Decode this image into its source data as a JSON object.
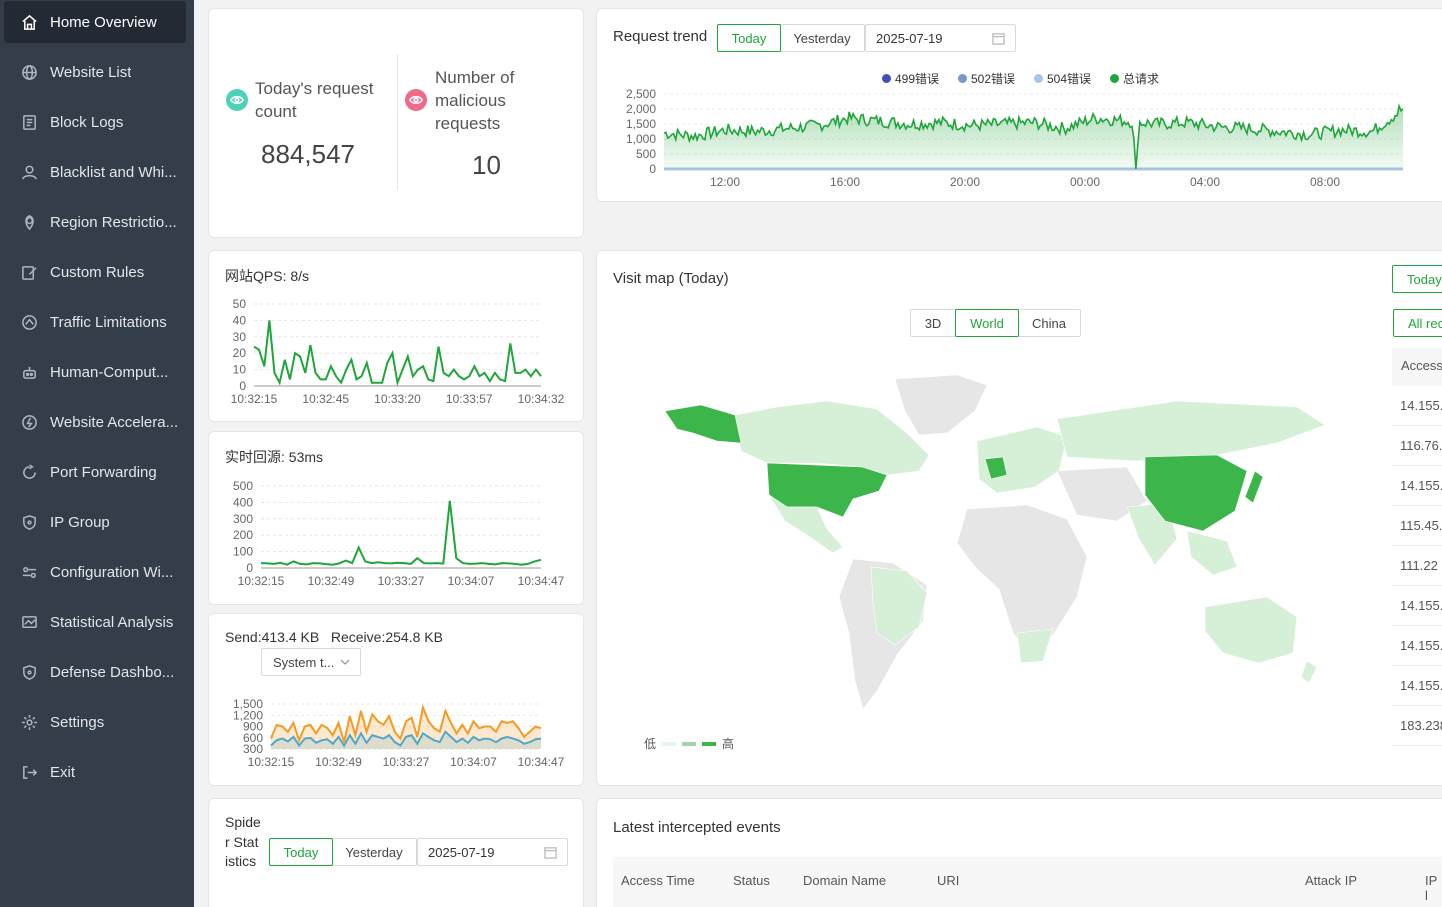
{
  "sidebar": {
    "items": [
      {
        "label": "Home Overview",
        "icon": "home-icon",
        "active": true
      },
      {
        "label": "Website List",
        "icon": "globe-icon"
      },
      {
        "label": "Block Logs",
        "icon": "log-icon"
      },
      {
        "label": "Blacklist and Whi...",
        "icon": "user-icon"
      },
      {
        "label": "Region Restrictio...",
        "icon": "location-icon"
      },
      {
        "label": "Custom Rules",
        "icon": "edit-icon"
      },
      {
        "label": "Traffic Limitations",
        "icon": "traffic-icon"
      },
      {
        "label": "Human-Comput...",
        "icon": "robot-icon"
      },
      {
        "label": "Website Accelera...",
        "icon": "lightning-icon"
      },
      {
        "label": "Port Forwarding",
        "icon": "forward-icon"
      },
      {
        "label": "IP Group",
        "icon": "shield-icon"
      },
      {
        "label": "Configuration Wi...",
        "icon": "config-icon"
      },
      {
        "label": "Statistical Analysis",
        "icon": "chart-icon"
      },
      {
        "label": "Defense Dashbo...",
        "icon": "shield-icon"
      },
      {
        "label": "Settings",
        "icon": "gear-icon"
      },
      {
        "label": "Exit",
        "icon": "exit-icon"
      }
    ]
  },
  "stats": {
    "requests_label": "Today's request count",
    "requests_value": "884,547",
    "malicious_label": "Number of malicious requests",
    "malicious_value": "10",
    "accent_green": "#20a53a",
    "accent_pink": "#f06b8a",
    "accent_teal": "#4fd1b5"
  },
  "trend": {
    "title": "Request trend",
    "tabs": [
      "Today",
      "Yesterday"
    ],
    "active_tab": "Today",
    "date": "2025-07-19"
  },
  "qps": {
    "title": "网站QPS: 8/s"
  },
  "origin": {
    "title": "实时回源: 53ms"
  },
  "traffic": {
    "send_label": "Send:",
    "send_value": "413.4 KB",
    "receive_label": "Receive:",
    "receive_value": "254.8 KB",
    "select_value": "System t..."
  },
  "spider": {
    "title": "Spider Statistics",
    "tabs": [
      "Today",
      "Yesterday"
    ],
    "active_tab": "Today",
    "date": "2025-07-19"
  },
  "map": {
    "title": "Visit map (Today)",
    "modes": [
      "3D",
      "World",
      "China"
    ],
    "active_mode": "World",
    "legend_low": "低",
    "legend_high": "高",
    "colors": {
      "high": "#3cb54a",
      "low": "#d6f0d8",
      "none": "#e6e6e6"
    }
  },
  "ip_panel": {
    "today_btn": "Today",
    "all_btn": "All rec",
    "header": "Access",
    "rows": [
      "14.155.",
      "116.76.",
      "14.155.",
      "115.45.",
      "111.22",
      "14.155.",
      "14.155.",
      "14.155.",
      "183.238"
    ]
  },
  "events": {
    "title": "Latest intercepted events",
    "columns": [
      "Access Time",
      "Status",
      "Domain Name",
      "URI",
      "Attack IP",
      "IP l"
    ]
  },
  "chart_data": [
    {
      "type": "line",
      "title": "Request trend",
      "series": [
        {
          "name": "499错误",
          "color": "#3f51b5",
          "values": [
            0,
            0,
            0,
            0,
            0,
            0,
            0,
            0,
            0,
            0,
            0,
            0,
            0,
            0,
            0,
            0,
            0,
            0,
            0,
            0,
            0,
            0,
            0,
            0,
            0
          ]
        },
        {
          "name": "502错误",
          "color": "#7b96c8",
          "values": [
            0,
            0,
            0,
            0,
            0,
            0,
            0,
            0,
            0,
            0,
            0,
            0,
            0,
            0,
            0,
            0,
            0,
            0,
            0,
            0,
            0,
            0,
            0,
            0,
            0
          ]
        },
        {
          "name": "504错误",
          "color": "#a9c4e8",
          "values": [
            0,
            0,
            0,
            0,
            0,
            0,
            0,
            0,
            0,
            0,
            0,
            0,
            0,
            0,
            0,
            0,
            0,
            0,
            0,
            0,
            0,
            0,
            0,
            0,
            0
          ]
        },
        {
          "name": "总请求",
          "color": "#20a53a",
          "values": [
            1200,
            1100,
            1300,
            1250,
            1350,
            1450,
            1700,
            1600,
            1500,
            1550,
            1450,
            1500,
            1550,
            1350,
            1700,
            1600,
            1500,
            1550,
            1400,
            1350,
            1250,
            1150,
            1300,
            1250,
            2000
          ]
        }
      ],
      "x_ticks": [
        "12:00",
        "16:00",
        "20:00",
        "00:00",
        "04:00",
        "08:00"
      ],
      "y_ticks": [
        "0",
        "500",
        "1,000",
        "1,500",
        "2,000",
        "2,500"
      ],
      "ylim": [
        0,
        2500
      ]
    },
    {
      "type": "line",
      "title": "网站QPS: 8/s",
      "x_ticks": [
        "10:32:15",
        "10:32:45",
        "10:33:20",
        "10:33:57",
        "10:34:32"
      ],
      "y_ticks": [
        "0",
        "10",
        "20",
        "30",
        "40",
        "50"
      ],
      "ylim": [
        0,
        50
      ],
      "series": [
        {
          "values": [
            24,
            22,
            12,
            40,
            8,
            2,
            16,
            4,
            20,
            18,
            8,
            25,
            8,
            4,
            4,
            12,
            6,
            2,
            10,
            16,
            4,
            6,
            14,
            2,
            2,
            2,
            14,
            20,
            2,
            10,
            18,
            6,
            10,
            12,
            4,
            3,
            24,
            8,
            6,
            10,
            6,
            4,
            6,
            12,
            6,
            8,
            3,
            8,
            4,
            3,
            26,
            8,
            8,
            10,
            6,
            10,
            6
          ]
        }
      ]
    },
    {
      "type": "line",
      "title": "实时回源: 53ms",
      "x_ticks": [
        "10:32:15",
        "10:32:49",
        "10:33:27",
        "10:34:07",
        "10:34:47"
      ],
      "y_ticks": [
        "0",
        "100",
        "200",
        "300",
        "400",
        "500"
      ],
      "ylim": [
        0,
        500
      ],
      "series": [
        {
          "values": [
            30,
            28,
            25,
            32,
            20,
            40,
            25,
            22,
            30,
            28,
            24,
            20,
            28,
            45,
            30,
            125,
            40,
            30,
            35,
            30,
            28,
            32,
            30,
            25,
            60,
            30,
            28,
            30,
            27,
            410,
            60,
            30,
            25,
            27,
            30,
            25,
            22,
            30,
            28,
            25,
            20,
            25,
            40,
            50
          ]
        }
      ]
    },
    {
      "type": "area",
      "title": "Send / Receive",
      "x_ticks": [
        "10:32:15",
        "10:32:49",
        "10:33:27",
        "10:34:07",
        "10:34:47"
      ],
      "y_ticks": [
        "300",
        "600",
        "900",
        "1,200",
        "1,500"
      ],
      "series": [
        {
          "name": "Send",
          "color": "#f59a23",
          "values": [
            500,
            900,
            850,
            700,
            950,
            450,
            850,
            900,
            650,
            900,
            800,
            600,
            950,
            400,
            1150,
            600,
            1300,
            700,
            1200,
            1000,
            900,
            1150,
            700,
            500,
            1000,
            1100,
            550,
            1400,
            1000,
            800,
            700,
            1300,
            950,
            650,
            900,
            650,
            1000,
            800,
            850,
            850,
            700,
            1000,
            950,
            1000,
            800,
            550,
            700,
            850,
            800
          ]
        },
        {
          "name": "Receive",
          "color": "#4fa8c9",
          "values": [
            300,
            450,
            500,
            420,
            550,
            300,
            500,
            520,
            380,
            450,
            480,
            350,
            550,
            300,
            600,
            350,
            650,
            380,
            600,
            550,
            500,
            600,
            400,
            300,
            550,
            600,
            350,
            650,
            550,
            450,
            400,
            700,
            550,
            400,
            500,
            380,
            550,
            450,
            500,
            480,
            400,
            500,
            550,
            500,
            450,
            350,
            400,
            480,
            500
          ]
        }
      ]
    }
  ]
}
